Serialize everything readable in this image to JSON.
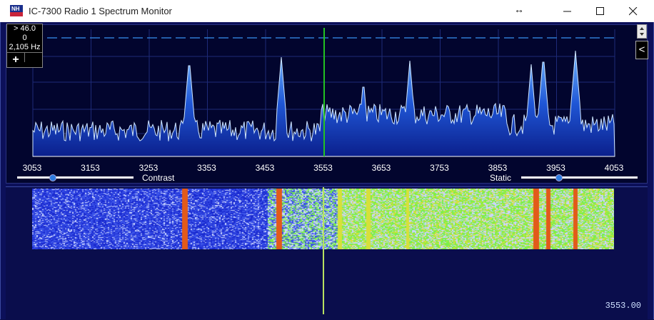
{
  "window": {
    "title": "IC-7300 Radio 1 Spectrum Monitor",
    "minimize_icon": "minimize-icon",
    "maximize_icon": "maximize-icon",
    "close_icon": "close-icon"
  },
  "readout": {
    "level": "> 46.0",
    "offset": "0",
    "span": "2,105 Hz",
    "add_button": "+"
  },
  "collapse_button": "<",
  "axis": {
    "labels": [
      "3053",
      "3153",
      "3253",
      "3353",
      "3453",
      "3553",
      "3653",
      "3753",
      "3853",
      "3953",
      "4053"
    ]
  },
  "controls": {
    "contrast_label": "Contrast",
    "static_label": "Static",
    "contrast_value": 0.3,
    "static_value": 0.32
  },
  "frequency_display": "3553.00",
  "colors": {
    "background": "#0c105a",
    "spectrum_fill": "#1a4fd0",
    "marker": "#22c322"
  }
}
